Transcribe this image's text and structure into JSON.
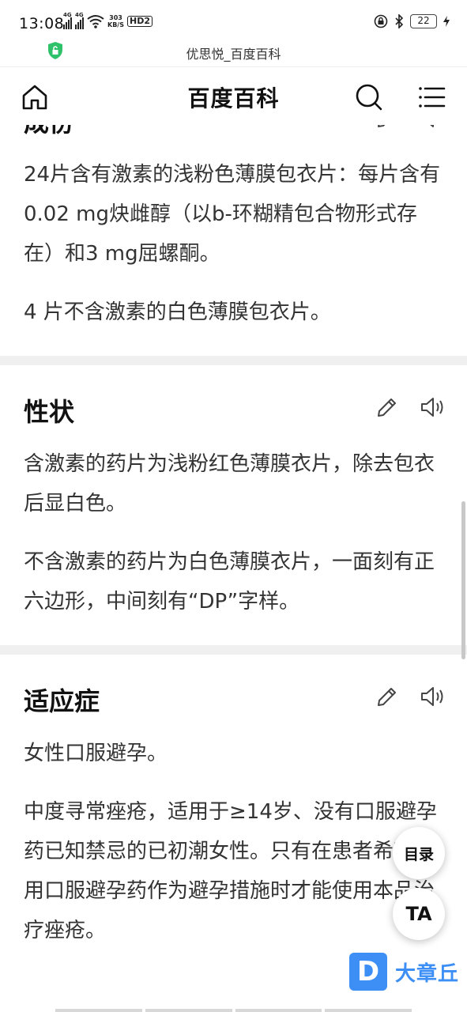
{
  "status_bar": {
    "time": "13:08",
    "network_speed_value": "303",
    "network_speed_unit": "KB/S",
    "hd_label": "HD2",
    "signal_label_1": "4G",
    "signal_label_2": "4G",
    "battery_level": "22"
  },
  "url_bar": {
    "title": "优思悦_百度百科",
    "shield_color": "#2fc26a"
  },
  "header": {
    "title": "百度百科"
  },
  "sections": [
    {
      "title": "成份",
      "paragraphs": [
        "24片含有激素的浅粉色薄膜包衣片：每片含有0.02 mg炔雌醇（以b-环糊精包合物形式存在）和3 mg屈螺酮。",
        "4 片不含激素的白色薄膜包衣片。"
      ]
    },
    {
      "title": "性状",
      "paragraphs": [
        "含激素的药片为浅粉红色薄膜衣片，除去包衣后显白色。",
        "不含激素的药片为白色薄膜衣片，一面刻有正六边形，中间刻有“DP”字样。"
      ]
    },
    {
      "title": "适应症",
      "paragraphs": [
        "女性口服避孕。",
        "中度寻常痤疮，适用于≥14岁、没有口服避孕药已知禁忌的已初潮女性。只有在患者希望使用口服避孕药作为避孕措施时才能使用本品治疗痤疮。"
      ]
    }
  ],
  "floating": {
    "toc_label": "目录",
    "ta_label": "TA"
  },
  "watermark": {
    "logo_letter": "D",
    "text": "大章丘",
    "color": "#3d8ff5"
  }
}
